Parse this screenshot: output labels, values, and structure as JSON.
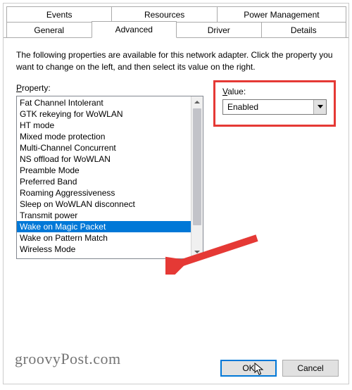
{
  "tabs": {
    "row1": [
      "Events",
      "Resources",
      "Power Management"
    ],
    "row2": [
      "General",
      "Advanced",
      "Driver",
      "Details"
    ],
    "active": "Advanced"
  },
  "description": "The following properties are available for this network adapter. Click the property you want to change on the left, and then select its value on the right.",
  "propertyLabel": "Property:",
  "valueLabel": "Value:",
  "properties": [
    "Fat Channel Intolerant",
    "GTK rekeying for WoWLAN",
    "HT mode",
    "Mixed mode protection",
    "Multi-Channel Concurrent",
    "NS offload for WoWLAN",
    "Preamble Mode",
    "Preferred Band",
    "Roaming Aggressiveness",
    "Sleep on WoWLAN disconnect",
    "Transmit power",
    "Wake on Magic Packet",
    "Wake on Pattern Match",
    "Wireless Mode"
  ],
  "selectedProperty": "Wake on Magic Packet",
  "value": {
    "selected": "Enabled"
  },
  "buttons": {
    "ok": "OK",
    "cancel": "Cancel"
  },
  "watermark": "groovyPost.com",
  "annotations": {
    "highlightValue": true
  }
}
